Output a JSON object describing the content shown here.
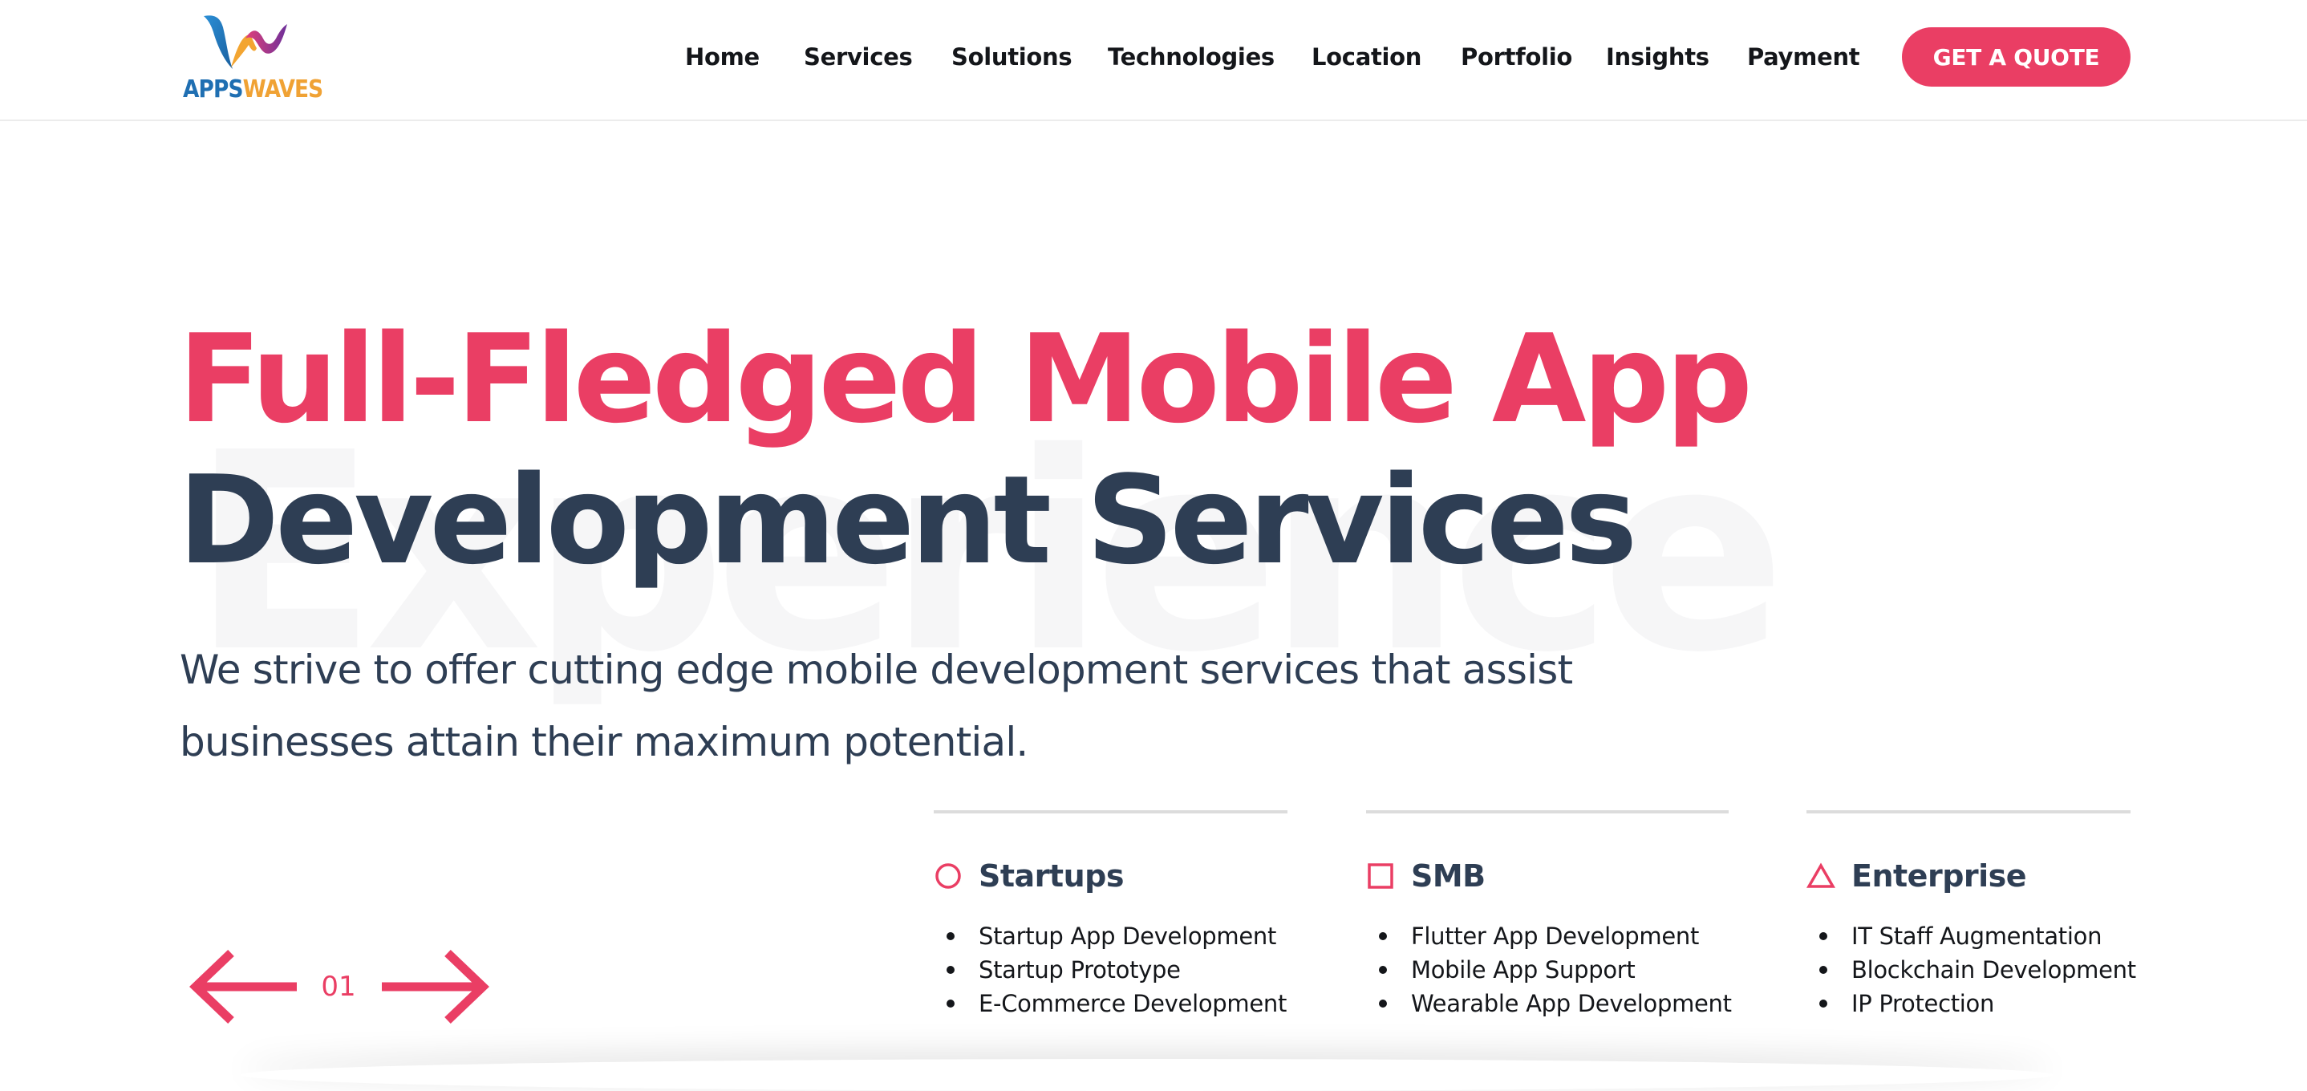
{
  "logo": {
    "apps": "APPS",
    "waves": "WAVES"
  },
  "nav": {
    "items": [
      "Home",
      "Services",
      "Solutions",
      "Technologies",
      "Location",
      "Portfolio",
      "Insights",
      "Payment"
    ],
    "cta": "GET A QUOTE"
  },
  "hero": {
    "watermark": "Experience",
    "title_line1": "Full-Fledged Mobile App",
    "title_line2": "Development Services",
    "subtitle": "We strive to offer cutting edge mobile development services that assist businesses attain their maximum potential."
  },
  "slider": {
    "current": "01"
  },
  "columns": [
    {
      "icon": "circle-icon",
      "title": "Startups",
      "items": [
        "Startup App Development",
        "Startup Prototype",
        "E-Commerce Development"
      ]
    },
    {
      "icon": "square-icon",
      "title": "SMB",
      "items": [
        "Flutter App Development",
        "Mobile App Support",
        "Wearable App Development"
      ]
    },
    {
      "icon": "triangle-icon",
      "title": "Enterprise",
      "items": [
        "IT Staff Augmentation",
        "Blockchain Development",
        "IP Protection"
      ]
    }
  ],
  "colors": {
    "accent": "#ea3e64",
    "heading": "#2e3e54",
    "text": "#14161a",
    "watermark": "#f6f6f7",
    "divider": "#dcdcdc"
  }
}
